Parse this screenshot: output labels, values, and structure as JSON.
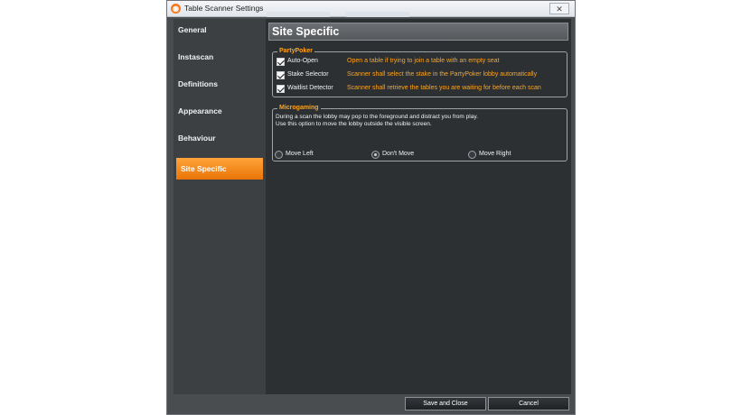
{
  "window": {
    "title": "Table Scanner Settings",
    "close": "✕"
  },
  "sidebar": {
    "items": [
      {
        "label": "General"
      },
      {
        "label": "Instascan"
      },
      {
        "label": "Definitions"
      },
      {
        "label": "Appearance"
      },
      {
        "label": "Behaviour"
      },
      {
        "label": "Site Specific"
      }
    ]
  },
  "page": {
    "title": "Site Specific"
  },
  "partypoker": {
    "label": "PartyPoker",
    "rows": [
      {
        "label": "Auto-Open",
        "checked": true,
        "description": "Open a table if trying to join a table with an empty seat"
      },
      {
        "label": "Stake Selector",
        "checked": true,
        "description": "Scanner shall select the stake in the PartyPoker lobby automatically"
      },
      {
        "label": "Waitlist Detector",
        "checked": true,
        "description": "Scanner shall retrieve the tables you are waiting for before each scan"
      }
    ]
  },
  "microgaming": {
    "label": "Microgaming",
    "info_line1": "During a scan the lobby may pop to the foreground and distract you from play.",
    "info_line2": "Use this option to move the lobby outside the visible screen.",
    "options": [
      {
        "label": "Move Left",
        "selected": false
      },
      {
        "label": "Don't Move",
        "selected": true
      },
      {
        "label": "Move Right",
        "selected": false
      }
    ]
  },
  "footer": {
    "save_label": "Save and Close",
    "cancel_label": "Cancel"
  },
  "colors": {
    "accent": "#ffa41c",
    "active_nav": "#f08410",
    "panel": "#2d3033",
    "sidebar": "#3c4043"
  }
}
